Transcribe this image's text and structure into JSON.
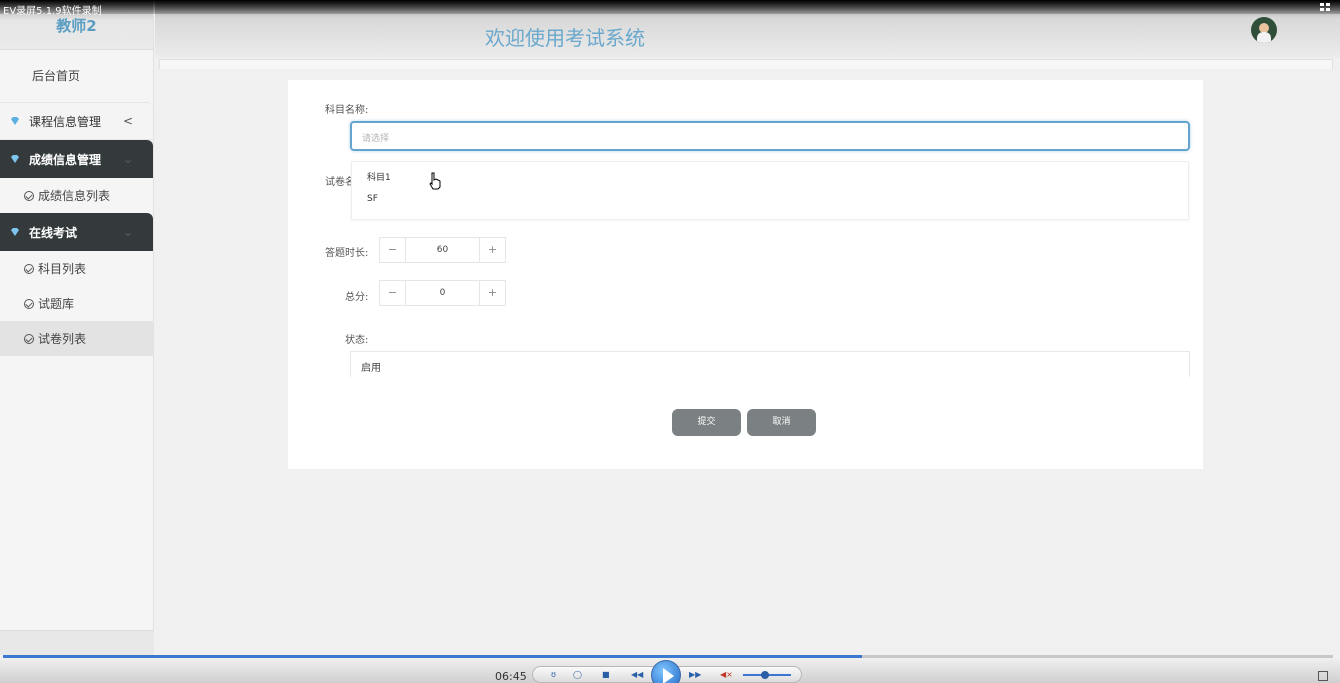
{
  "recorder": {
    "title": "EV录屏5.1.9软件录制"
  },
  "sidebar": {
    "brand": "教师2",
    "home": "后台首页",
    "groups": [
      {
        "label": "课程信息管理",
        "chevron": "<"
      },
      {
        "label": "成绩信息管理",
        "chevron": ""
      },
      {
        "label": "在线考试",
        "chevron": ""
      }
    ],
    "subitems": [
      "成绩信息列表",
      "科目列表",
      "试题库",
      "试卷列表"
    ]
  },
  "header": {
    "title": "欢迎使用考试系统"
  },
  "form": {
    "subject_label": "科目名称:",
    "subject_placeholder": "请选择",
    "dropdown_options": [
      "科目1",
      "SF"
    ],
    "paper_label": "试卷名",
    "duration_label": "答题时长:",
    "duration_value": "60",
    "score_label": "总分:",
    "score_value": "0",
    "minus": "−",
    "plus": "+",
    "status_label": "状态:",
    "status_value": "启用",
    "submit_label": "提交",
    "cancel_label": "取消"
  },
  "player": {
    "time": "06:45",
    "progress": 0.646,
    "volume": 0.45
  },
  "colors": {
    "accent": "#66a4d0",
    "title": "#6aa8cc",
    "dark_menu": "#343a3c",
    "button": "#7b8083"
  }
}
